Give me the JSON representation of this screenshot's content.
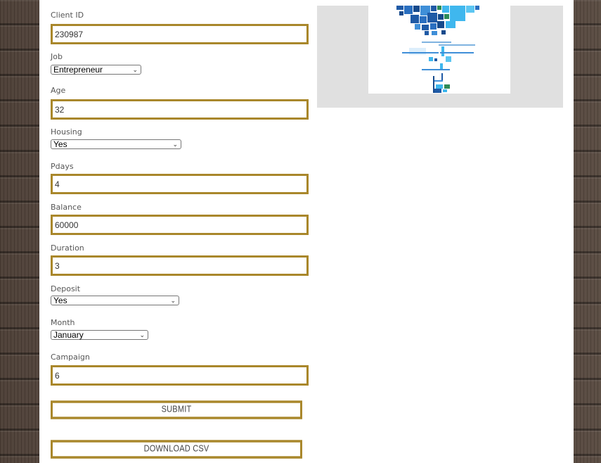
{
  "form": {
    "client_id": {
      "label": "Client ID",
      "value": "230987"
    },
    "job": {
      "label": "Job",
      "value": "Entrepreneur"
    },
    "age": {
      "label": "Age",
      "value": "32"
    },
    "housing": {
      "label": "Housing",
      "value": "Yes"
    },
    "pdays": {
      "label": "Pdays",
      "value": "4"
    },
    "balance": {
      "label": "Balance",
      "value": "60000"
    },
    "duration": {
      "label": "Duration",
      "value": "3"
    },
    "deposit": {
      "label": "Deposit",
      "value": "Yes"
    },
    "month": {
      "label": "Month",
      "value": "January"
    },
    "campaign": {
      "label": "Campaign",
      "value": "6"
    }
  },
  "buttons": {
    "submit": "SUBMIT",
    "download": "DOWNLOAD CSV"
  },
  "colors": {
    "field_border": "#a9872b",
    "image_panel": "#e0e0e0",
    "plot_dark_blue": "#1f5aa6",
    "plot_light_blue": "#3fb7ee"
  }
}
